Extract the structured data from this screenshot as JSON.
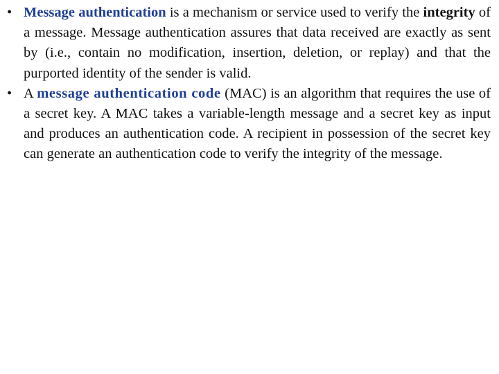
{
  "bullet_glyph": "•",
  "bullets": [
    {
      "highlight": "Message authentication",
      "text1": " is a mechanism or service used to verify the ",
      "bold": "integrity",
      "text2": " of a message. Message authentication assures that data received are exactly as sent by (i.e., contain no modification, insertion, deletion, or replay) and that the purported identity of the sender is valid."
    },
    {
      "lead": "A ",
      "highlight": "message authentication code",
      "text1": " (MAC) is an algorithm that requires the use of a secret key. A MAC takes a variable-length message and a secret key as input and produces an authentication code. A recipient in possession of the secret key can generate an authentication code to verify the integrity of the message."
    }
  ],
  "colors": {
    "highlight": "#1f3f95",
    "text": "#111111",
    "background": "#ffffff"
  }
}
